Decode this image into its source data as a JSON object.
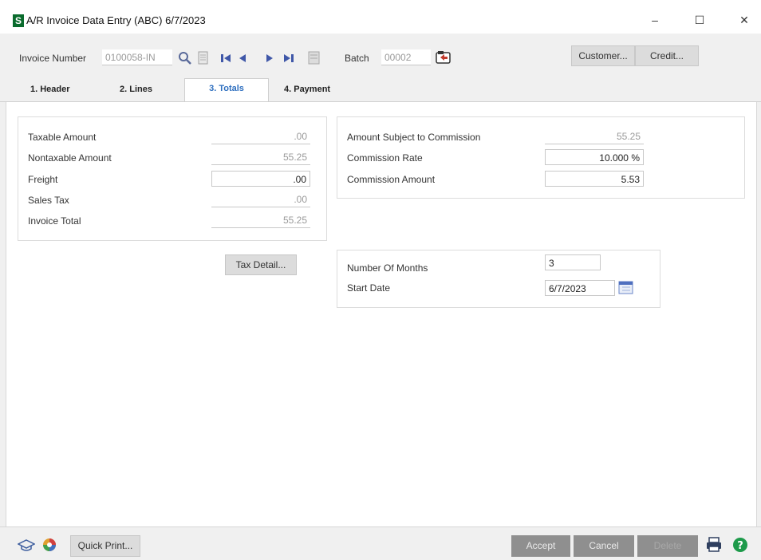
{
  "window": {
    "app_icon_letter": "S",
    "title": "A/R Invoice Data Entry (ABC) 6/7/2023",
    "minimize": "–",
    "maximize": "☐",
    "close": "✕"
  },
  "toolbar": {
    "invoice_label": "Invoice Number",
    "invoice_value": "0100058-IN",
    "batch_label": "Batch",
    "batch_value": "00002",
    "customer_button": "Customer...",
    "credit_button": "Credit..."
  },
  "tabs": [
    {
      "label": "1. Header"
    },
    {
      "label": "2. Lines"
    },
    {
      "label": "3. Totals"
    },
    {
      "label": "4. Payment"
    }
  ],
  "totals": {
    "taxable_label": "Taxable Amount",
    "taxable_value": ".00",
    "nontaxable_label": "Nontaxable Amount",
    "nontaxable_value": "55.25",
    "freight_label": "Freight",
    "freight_value": ".00",
    "sales_tax_label": "Sales Tax",
    "sales_tax_value": ".00",
    "invoice_total_label": "Invoice Total",
    "invoice_total_value": "55.25",
    "tax_detail_button": "Tax Detail..."
  },
  "commission": {
    "subject_label": "Amount Subject to Commission",
    "subject_value": "55.25",
    "rate_label": "Commission Rate",
    "rate_value": "10.000 %",
    "amount_label": "Commission Amount",
    "amount_value": "5.53"
  },
  "schedule": {
    "months_label": "Number Of Months",
    "months_value": "3",
    "start_label": "Start Date",
    "start_value": "6/7/2023"
  },
  "footer": {
    "quick_print": "Quick Print...",
    "accept": "Accept",
    "cancel": "Cancel",
    "delete": "Delete"
  },
  "icons": {
    "search": "search-icon",
    "memo": "memo-icon",
    "first": "first-record-icon",
    "prev": "previous-record-icon",
    "next": "next-record-icon",
    "last": "last-record-icon",
    "calendar": "calendar-icon",
    "printer": "printer-icon",
    "help": "help-icon"
  },
  "colors": {
    "active_tab": "#2e6fbf",
    "app_icon": "#0a6b2d",
    "help": "#1d9a4a"
  }
}
